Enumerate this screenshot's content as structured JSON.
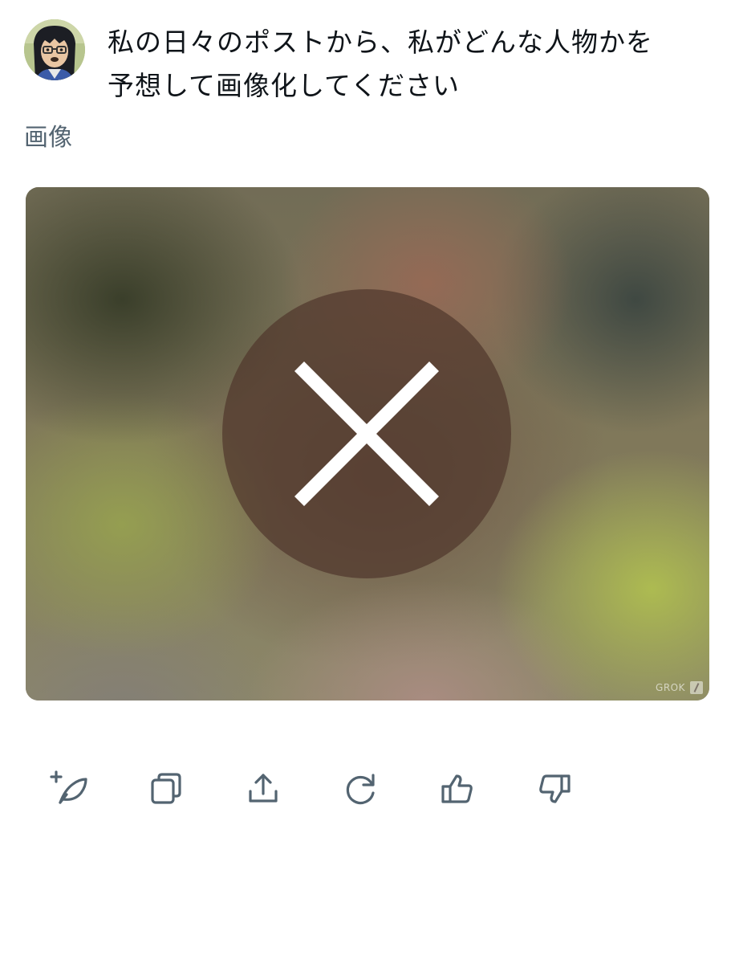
{
  "prompt": {
    "text_line1": "私の日々のポストから、私がどんな人物かを",
    "text_line2": "予想して画像化してください"
  },
  "section_label": "画像",
  "image": {
    "status": "error",
    "status_icon": "x-icon",
    "watermark": "GROK"
  },
  "actions": [
    {
      "name": "regenerate-with-edit",
      "icon": "feather-plus-icon"
    },
    {
      "name": "copy",
      "icon": "copy-icon"
    },
    {
      "name": "share",
      "icon": "share-upload-icon"
    },
    {
      "name": "regenerate",
      "icon": "refresh-icon"
    },
    {
      "name": "like",
      "icon": "thumbs-up-icon"
    },
    {
      "name": "dislike",
      "icon": "thumbs-down-icon"
    }
  ],
  "colors": {
    "text_primary": "#0f1419",
    "text_secondary": "#536471",
    "icon": "#536471"
  }
}
